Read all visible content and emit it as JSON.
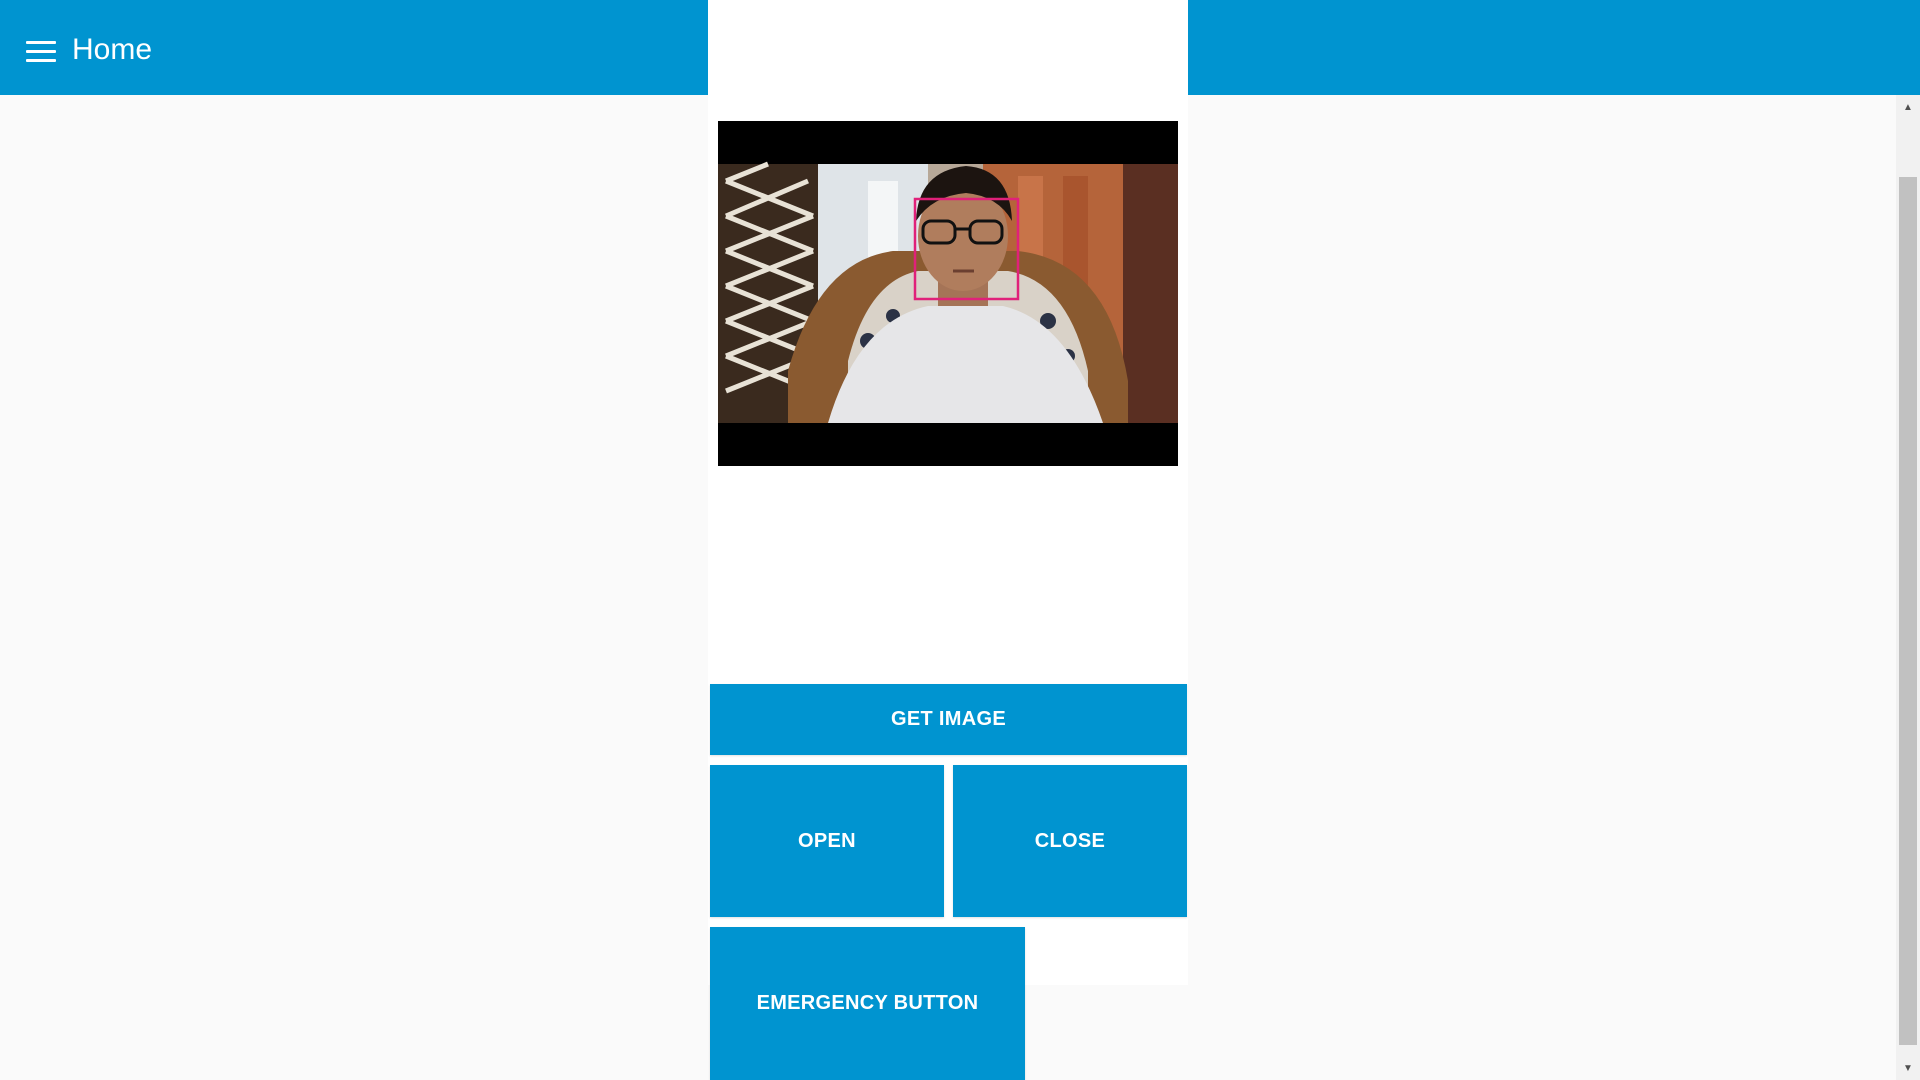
{
  "header": {
    "title": "Home",
    "menu_icon": "hamburger-menu-icon",
    "background_color": "#0094d0"
  },
  "camera": {
    "description_icon": "camera-feed",
    "face_box_color": "#e0217a"
  },
  "buttons": {
    "get_image": "GET IMAGE",
    "open": "OPEN",
    "close": "CLOSE",
    "emergency": "EMERGENCY BUTTON"
  },
  "colors": {
    "accent": "#0094d0",
    "page_background": "#fafafa",
    "card_background": "#ffffff"
  }
}
